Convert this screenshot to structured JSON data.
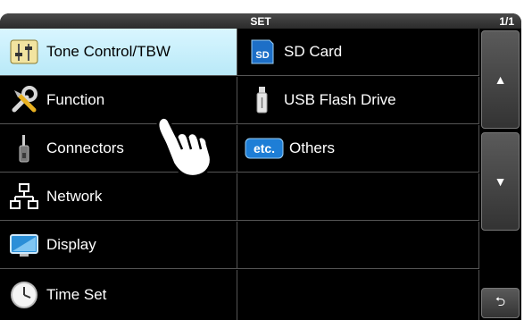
{
  "header": {
    "title": "SET",
    "page": "1/1"
  },
  "menu": {
    "left": [
      {
        "label": "Tone Control/TBW",
        "icon": "tone-control-icon",
        "selected": true
      },
      {
        "label": "Function",
        "icon": "tools-icon"
      },
      {
        "label": "Connectors",
        "icon": "connector-plug-icon"
      },
      {
        "label": "Network",
        "icon": "network-icon"
      },
      {
        "label": "Display",
        "icon": "monitor-icon"
      },
      {
        "label": "Time Set",
        "icon": "clock-icon"
      }
    ],
    "right": [
      {
        "label": "SD Card",
        "icon": "sd-card-icon",
        "icon_text": "SD"
      },
      {
        "label": "USB Flash Drive",
        "icon": "usb-drive-icon"
      },
      {
        "label": "Others",
        "icon": "etc-icon",
        "icon_text": "etc."
      }
    ]
  },
  "scroll": {
    "up": "▲",
    "down": "▼",
    "back": "⮌"
  },
  "colors": {
    "selected_bg": "#c9f0fb",
    "panel_bg": "#000000",
    "text": "#ffffff"
  }
}
